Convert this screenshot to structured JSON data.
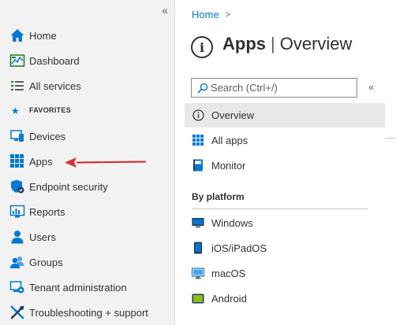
{
  "nav": {
    "collapse_glyph": "«",
    "items": [
      {
        "label": "Home",
        "icon": "home-icon"
      },
      {
        "label": "Dashboard",
        "icon": "dashboard-icon"
      },
      {
        "label": "All services",
        "icon": "list-icon"
      },
      {
        "label": "Devices",
        "icon": "devices-icon"
      },
      {
        "label": "Apps",
        "icon": "apps-grid-icon"
      },
      {
        "label": "Endpoint security",
        "icon": "shield-icon"
      },
      {
        "label": "Reports",
        "icon": "reports-icon"
      },
      {
        "label": "Users",
        "icon": "user-icon"
      },
      {
        "label": "Groups",
        "icon": "groups-icon"
      },
      {
        "label": "Tenant administration",
        "icon": "tenant-admin-icon"
      },
      {
        "label": "Troubleshooting + support",
        "icon": "tools-icon"
      }
    ],
    "favorites_label": "FAVORITES"
  },
  "breadcrumb": {
    "home": "Home",
    "separator": ">"
  },
  "header": {
    "info_glyph": "i",
    "title": "Apps",
    "separator": "|",
    "subtitle": "Overview"
  },
  "search": {
    "placeholder": "Search (Ctrl+/)",
    "collapse_glyph": "«"
  },
  "menu": {
    "items": [
      {
        "label": "Overview",
        "icon": "info-icon",
        "selected": true
      },
      {
        "label": "All apps",
        "icon": "apps-grid-icon"
      },
      {
        "label": "Monitor",
        "icon": "monitor-book-icon"
      }
    ],
    "platform_header": "By platform",
    "platforms": [
      {
        "label": "Windows",
        "icon": "windows-monitor-icon"
      },
      {
        "label": "iOS/iPadOS",
        "icon": "phone-icon"
      },
      {
        "label": "macOS",
        "icon": "mac-monitor-icon"
      },
      {
        "label": "Android",
        "icon": "android-icon"
      }
    ]
  },
  "colors": {
    "accent": "#0078d4",
    "annotation_arrow": "#d13438",
    "nav_background": "#f2f2f2",
    "selected_background": "#e8e8e8"
  }
}
